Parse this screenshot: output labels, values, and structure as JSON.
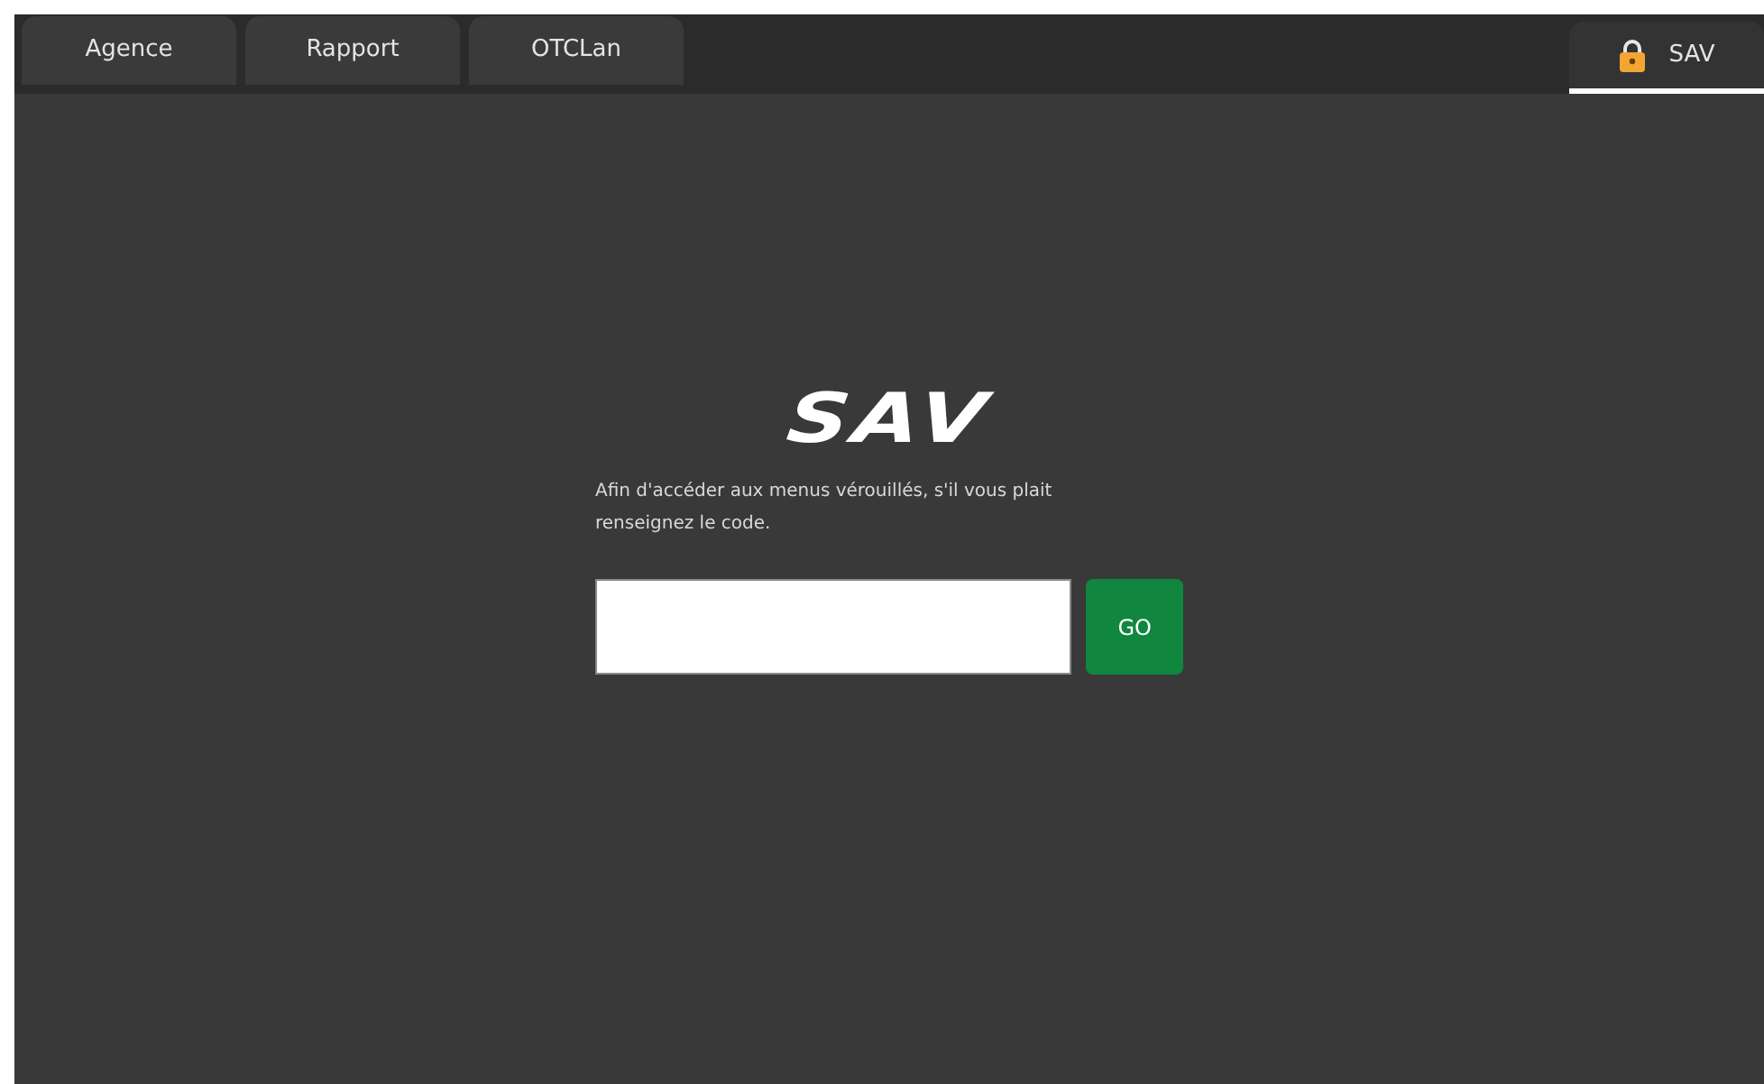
{
  "tabs": [
    {
      "label": "Agence",
      "selected": false,
      "locked": false
    },
    {
      "label": "Rapport",
      "selected": false,
      "locked": false
    },
    {
      "label": "OTCLan",
      "selected": false,
      "locked": false
    }
  ],
  "right_tab": {
    "label": "SAV",
    "selected": true,
    "locked": true
  },
  "login": {
    "title": "SAV",
    "message": "Afin d'accéder aux menus vérouillés, s'il vous plait renseignez le code.",
    "button": "GO"
  }
}
